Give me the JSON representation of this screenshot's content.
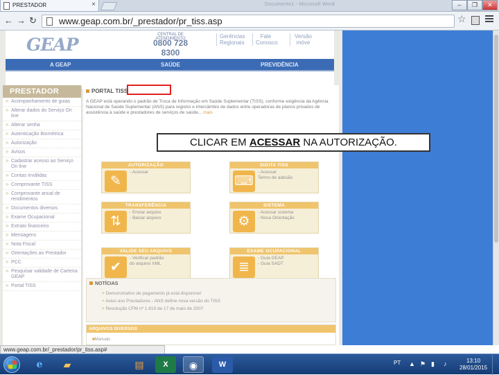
{
  "browser": {
    "tab_title": "PRESTADOR",
    "window_title_ghost": "Documento1 - Microsoft Word",
    "url": "www.geap.com.br/_prestador/pr_tiss.asp",
    "window_controls": [
      "–",
      "❐",
      "✕"
    ]
  },
  "site": {
    "logo": "GEAP",
    "central_label": "CENTRAL DE ATENDIMENTO",
    "phone": "0800 728 8300",
    "header_links": [
      "Gerências Regionais",
      "Fale Conosco",
      "Versão móve"
    ],
    "nav": [
      "A GEAP",
      "SAÚDE",
      "PREVIDÊNCIA"
    ]
  },
  "sidebar": {
    "title": "PRESTADOR",
    "items": [
      "Acompanhamento de guias",
      "Alterar dados do Serviço On line",
      "Alterar senha",
      "Autenticação Biométrica",
      "Autorização",
      "Avisos",
      "Cadastrar acesso ao Serviço On line",
      "Contas inválidas",
      "Comprovante TISS",
      "Comprovante anual de rendimentos",
      "Documentos diversos",
      "Exame Ocupacional",
      "Extrato financeiro",
      "Mensagens",
      "Nota Fiscal",
      "Orientações ao Prestador",
      "PCC",
      "Pesquisar validade de Carteira GEAP",
      "Portal TISS"
    ]
  },
  "content": {
    "section_title": "PORTAL TISS",
    "intro": "A GEAP está operando o padrão de Troca de Informação em Saúde Suplementar (TISS), conforme exigência da Agência Nacional de Saúde Suplementar (ANS) para registro e intercâmbio de dados entre operadoras de planos privados de assistência à saúde e prestadores de serviços de saúde...",
    "intro_more": "mais",
    "boxes": [
      {
        "title": "AUTORIZAÇÃO",
        "icon": "autorizacao-icon",
        "glyph": "✎",
        "links": [
          "- Acessar"
        ]
      },
      {
        "title": "DIGITA TISS",
        "icon": "keyboard-icon",
        "glyph": "⌨",
        "links": [
          "- Acessar",
          "Termo de adesão"
        ]
      },
      {
        "title": "TRANSFERÊNCIA",
        "icon": "transfer-icon",
        "glyph": "⇅",
        "links": [
          "- Enviar arquivo",
          "- Baixar arquivo"
        ]
      },
      {
        "title": "SISTEMA",
        "icon": "gear-icon",
        "glyph": "⚙",
        "links": [
          "- Acessar sistema",
          "- Nova Orientação"
        ]
      },
      {
        "title": "VALIDE SEU ARQUIVO",
        "icon": "checkmark-icon",
        "glyph": "✔",
        "links": [
          "- Verificar padrão",
          "do arquivo XML"
        ]
      },
      {
        "title": "EXAME OCUPACIONAL",
        "icon": "document-icon",
        "glyph": "≣",
        "links": [
          "- Guia GEAP",
          "- Guia SADT"
        ]
      }
    ],
    "news_title": "NOTÍCIAS",
    "news": [
      "Demonstrativo de pagamento já está disponível",
      "Aviso aos Prestadores - ANS define nova versão do TISS",
      "Resolução CFM nº 1.819 de 17 de maio de 2007"
    ],
    "arquivos_title": "ARQUIVOS DIVERSOS",
    "arquivos_item": "Manuais"
  },
  "annotation": {
    "callout_prefix": "CLICAR EM ",
    "callout_keyword": "ACESSAR",
    "callout_suffix": " NA AUTORIZAÇÃO."
  },
  "status_bar": "www.geap.com.br/_prestador/pr_tiss.asp#",
  "taskbar": {
    "lang": "PT",
    "time": "13:10",
    "date": "28/01/2015"
  }
}
